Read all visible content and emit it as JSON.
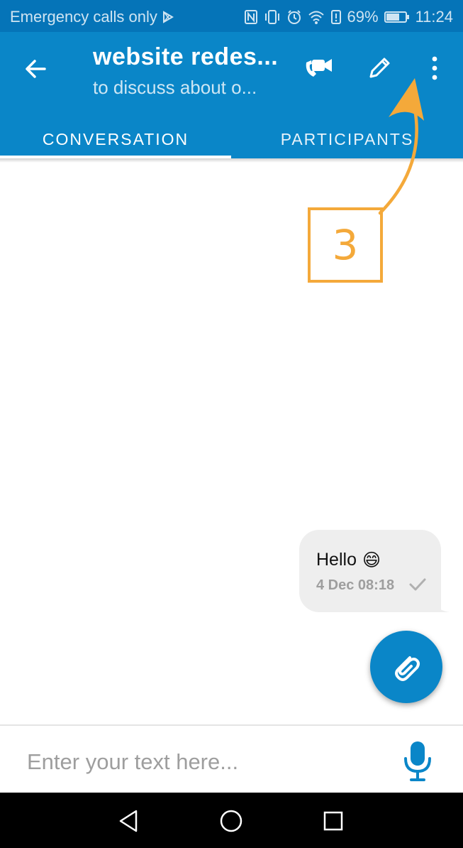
{
  "status_bar": {
    "carrier_text": "Emergency calls only",
    "battery_percent": "69%",
    "time": "11:24",
    "icons": [
      "play-store-icon",
      "nfc-icon",
      "vibrate-icon",
      "alarm-icon",
      "wifi-icon",
      "data-saver-icon",
      "battery-icon"
    ]
  },
  "header": {
    "title": "website redes...",
    "subtitle": "to discuss about o...",
    "icons": [
      "back-arrow-icon",
      "video-call-icon",
      "edit-pencil-icon",
      "more-vert-icon"
    ]
  },
  "tabs": [
    {
      "label": "CONVERSATION",
      "selected": true
    },
    {
      "label": "PARTICIPANTS",
      "selected": false
    }
  ],
  "annotation": {
    "label": "3",
    "color": "#f4a93a"
  },
  "messages": [
    {
      "text": "Hello",
      "emoji": "😄",
      "time": "4 Dec 08:18",
      "status_icon": "check-icon"
    }
  ],
  "composer": {
    "placeholder": "Enter your text here...",
    "value": ""
  },
  "colors": {
    "primary": "#0a86c8",
    "status_bar": "#0574b8",
    "annotation": "#f4a93a",
    "bubble": "#eeeeee"
  }
}
